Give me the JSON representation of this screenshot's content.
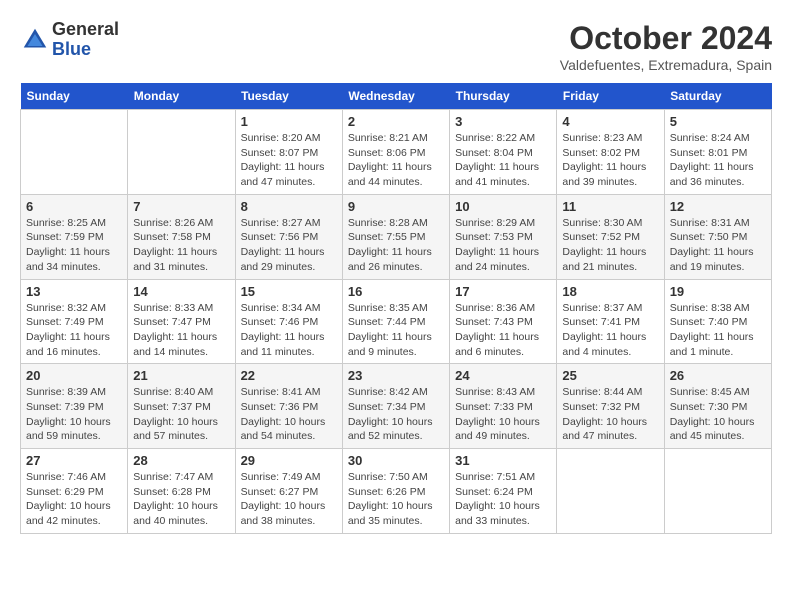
{
  "logo": {
    "general": "General",
    "blue": "Blue"
  },
  "title": "October 2024",
  "subtitle": "Valdefuentes, Extremadura, Spain",
  "headers": [
    "Sunday",
    "Monday",
    "Tuesday",
    "Wednesday",
    "Thursday",
    "Friday",
    "Saturday"
  ],
  "weeks": [
    [
      {
        "day": "",
        "sunrise": "",
        "sunset": "",
        "daylight": ""
      },
      {
        "day": "",
        "sunrise": "",
        "sunset": "",
        "daylight": ""
      },
      {
        "day": "1",
        "sunrise": "Sunrise: 8:20 AM",
        "sunset": "Sunset: 8:07 PM",
        "daylight": "Daylight: 11 hours and 47 minutes."
      },
      {
        "day": "2",
        "sunrise": "Sunrise: 8:21 AM",
        "sunset": "Sunset: 8:06 PM",
        "daylight": "Daylight: 11 hours and 44 minutes."
      },
      {
        "day": "3",
        "sunrise": "Sunrise: 8:22 AM",
        "sunset": "Sunset: 8:04 PM",
        "daylight": "Daylight: 11 hours and 41 minutes."
      },
      {
        "day": "4",
        "sunrise": "Sunrise: 8:23 AM",
        "sunset": "Sunset: 8:02 PM",
        "daylight": "Daylight: 11 hours and 39 minutes."
      },
      {
        "day": "5",
        "sunrise": "Sunrise: 8:24 AM",
        "sunset": "Sunset: 8:01 PM",
        "daylight": "Daylight: 11 hours and 36 minutes."
      }
    ],
    [
      {
        "day": "6",
        "sunrise": "Sunrise: 8:25 AM",
        "sunset": "Sunset: 7:59 PM",
        "daylight": "Daylight: 11 hours and 34 minutes."
      },
      {
        "day": "7",
        "sunrise": "Sunrise: 8:26 AM",
        "sunset": "Sunset: 7:58 PM",
        "daylight": "Daylight: 11 hours and 31 minutes."
      },
      {
        "day": "8",
        "sunrise": "Sunrise: 8:27 AM",
        "sunset": "Sunset: 7:56 PM",
        "daylight": "Daylight: 11 hours and 29 minutes."
      },
      {
        "day": "9",
        "sunrise": "Sunrise: 8:28 AM",
        "sunset": "Sunset: 7:55 PM",
        "daylight": "Daylight: 11 hours and 26 minutes."
      },
      {
        "day": "10",
        "sunrise": "Sunrise: 8:29 AM",
        "sunset": "Sunset: 7:53 PM",
        "daylight": "Daylight: 11 hours and 24 minutes."
      },
      {
        "day": "11",
        "sunrise": "Sunrise: 8:30 AM",
        "sunset": "Sunset: 7:52 PM",
        "daylight": "Daylight: 11 hours and 21 minutes."
      },
      {
        "day": "12",
        "sunrise": "Sunrise: 8:31 AM",
        "sunset": "Sunset: 7:50 PM",
        "daylight": "Daylight: 11 hours and 19 minutes."
      }
    ],
    [
      {
        "day": "13",
        "sunrise": "Sunrise: 8:32 AM",
        "sunset": "Sunset: 7:49 PM",
        "daylight": "Daylight: 11 hours and 16 minutes."
      },
      {
        "day": "14",
        "sunrise": "Sunrise: 8:33 AM",
        "sunset": "Sunset: 7:47 PM",
        "daylight": "Daylight: 11 hours and 14 minutes."
      },
      {
        "day": "15",
        "sunrise": "Sunrise: 8:34 AM",
        "sunset": "Sunset: 7:46 PM",
        "daylight": "Daylight: 11 hours and 11 minutes."
      },
      {
        "day": "16",
        "sunrise": "Sunrise: 8:35 AM",
        "sunset": "Sunset: 7:44 PM",
        "daylight": "Daylight: 11 hours and 9 minutes."
      },
      {
        "day": "17",
        "sunrise": "Sunrise: 8:36 AM",
        "sunset": "Sunset: 7:43 PM",
        "daylight": "Daylight: 11 hours and 6 minutes."
      },
      {
        "day": "18",
        "sunrise": "Sunrise: 8:37 AM",
        "sunset": "Sunset: 7:41 PM",
        "daylight": "Daylight: 11 hours and 4 minutes."
      },
      {
        "day": "19",
        "sunrise": "Sunrise: 8:38 AM",
        "sunset": "Sunset: 7:40 PM",
        "daylight": "Daylight: 11 hours and 1 minute."
      }
    ],
    [
      {
        "day": "20",
        "sunrise": "Sunrise: 8:39 AM",
        "sunset": "Sunset: 7:39 PM",
        "daylight": "Daylight: 10 hours and 59 minutes."
      },
      {
        "day": "21",
        "sunrise": "Sunrise: 8:40 AM",
        "sunset": "Sunset: 7:37 PM",
        "daylight": "Daylight: 10 hours and 57 minutes."
      },
      {
        "day": "22",
        "sunrise": "Sunrise: 8:41 AM",
        "sunset": "Sunset: 7:36 PM",
        "daylight": "Daylight: 10 hours and 54 minutes."
      },
      {
        "day": "23",
        "sunrise": "Sunrise: 8:42 AM",
        "sunset": "Sunset: 7:34 PM",
        "daylight": "Daylight: 10 hours and 52 minutes."
      },
      {
        "day": "24",
        "sunrise": "Sunrise: 8:43 AM",
        "sunset": "Sunset: 7:33 PM",
        "daylight": "Daylight: 10 hours and 49 minutes."
      },
      {
        "day": "25",
        "sunrise": "Sunrise: 8:44 AM",
        "sunset": "Sunset: 7:32 PM",
        "daylight": "Daylight: 10 hours and 47 minutes."
      },
      {
        "day": "26",
        "sunrise": "Sunrise: 8:45 AM",
        "sunset": "Sunset: 7:30 PM",
        "daylight": "Daylight: 10 hours and 45 minutes."
      }
    ],
    [
      {
        "day": "27",
        "sunrise": "Sunrise: 7:46 AM",
        "sunset": "Sunset: 6:29 PM",
        "daylight": "Daylight: 10 hours and 42 minutes."
      },
      {
        "day": "28",
        "sunrise": "Sunrise: 7:47 AM",
        "sunset": "Sunset: 6:28 PM",
        "daylight": "Daylight: 10 hours and 40 minutes."
      },
      {
        "day": "29",
        "sunrise": "Sunrise: 7:49 AM",
        "sunset": "Sunset: 6:27 PM",
        "daylight": "Daylight: 10 hours and 38 minutes."
      },
      {
        "day": "30",
        "sunrise": "Sunrise: 7:50 AM",
        "sunset": "Sunset: 6:26 PM",
        "daylight": "Daylight: 10 hours and 35 minutes."
      },
      {
        "day": "31",
        "sunrise": "Sunrise: 7:51 AM",
        "sunset": "Sunset: 6:24 PM",
        "daylight": "Daylight: 10 hours and 33 minutes."
      },
      {
        "day": "",
        "sunrise": "",
        "sunset": "",
        "daylight": ""
      },
      {
        "day": "",
        "sunrise": "",
        "sunset": "",
        "daylight": ""
      }
    ]
  ]
}
